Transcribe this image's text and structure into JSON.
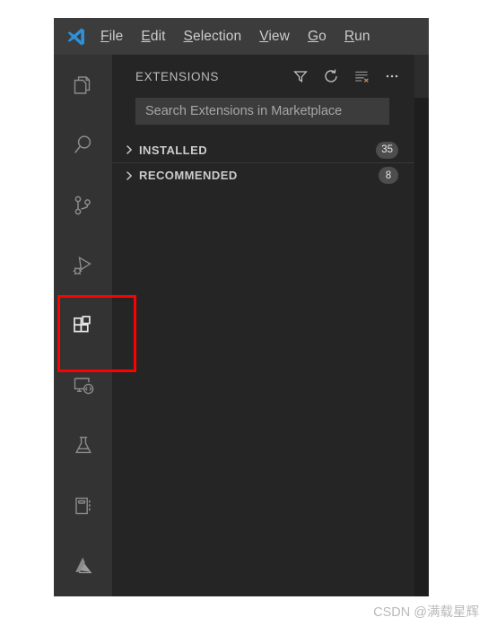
{
  "window": {
    "menu": [
      {
        "mnemonic": "F",
        "rest": "ile",
        "name": "file"
      },
      {
        "mnemonic": "E",
        "rest": "dit",
        "name": "edit"
      },
      {
        "mnemonic": "S",
        "rest": "election",
        "name": "selection"
      },
      {
        "mnemonic": "V",
        "rest": "iew",
        "name": "view"
      },
      {
        "mnemonic": "G",
        "rest": "o",
        "name": "go"
      },
      {
        "mnemonic": "R",
        "rest": "un",
        "name": "run"
      }
    ]
  },
  "activity_bar": {
    "items": [
      {
        "icon": "explorer-files-icon",
        "label": "Explorer",
        "active": false
      },
      {
        "icon": "search-magnifier-icon",
        "label": "Search",
        "active": false
      },
      {
        "icon": "source-control-branch-icon",
        "label": "Source Control",
        "active": false
      },
      {
        "icon": "run-and-debug-icon",
        "label": "Run and Debug",
        "active": false
      },
      {
        "icon": "extensions-blocks-icon",
        "label": "Extensions",
        "active": true
      },
      {
        "icon": "remote-explorer-icon",
        "label": "Remote Explorer",
        "active": false
      },
      {
        "icon": "testing-flask-icon",
        "label": "Testing",
        "active": false
      },
      {
        "icon": "notebook-icon",
        "label": "Jupyter",
        "active": false
      },
      {
        "icon": "azure-icon",
        "label": "Azure",
        "active": false
      }
    ]
  },
  "sidebar": {
    "title": "EXTENSIONS",
    "actions": [
      {
        "icon": "filter-funnel-icon",
        "label": "Filter Extensions"
      },
      {
        "icon": "refresh-icon",
        "label": "Refresh"
      },
      {
        "icon": "clear-filter-icon",
        "label": "Clear Extensions Search Results"
      },
      {
        "icon": "more-actions-icon",
        "label": "Views and More Actions..."
      }
    ],
    "search": {
      "placeholder": "Search Extensions in Marketplace",
      "value": ""
    },
    "sections": [
      {
        "label": "INSTALLED",
        "count": "35",
        "expanded": false
      },
      {
        "label": "RECOMMENDED",
        "count": "8",
        "expanded": false
      }
    ]
  },
  "annotation": {
    "highlight_target": "extensions-blocks-icon",
    "color": "#fe0000"
  },
  "watermark": {
    "text": "CSDN @满载星辉"
  }
}
